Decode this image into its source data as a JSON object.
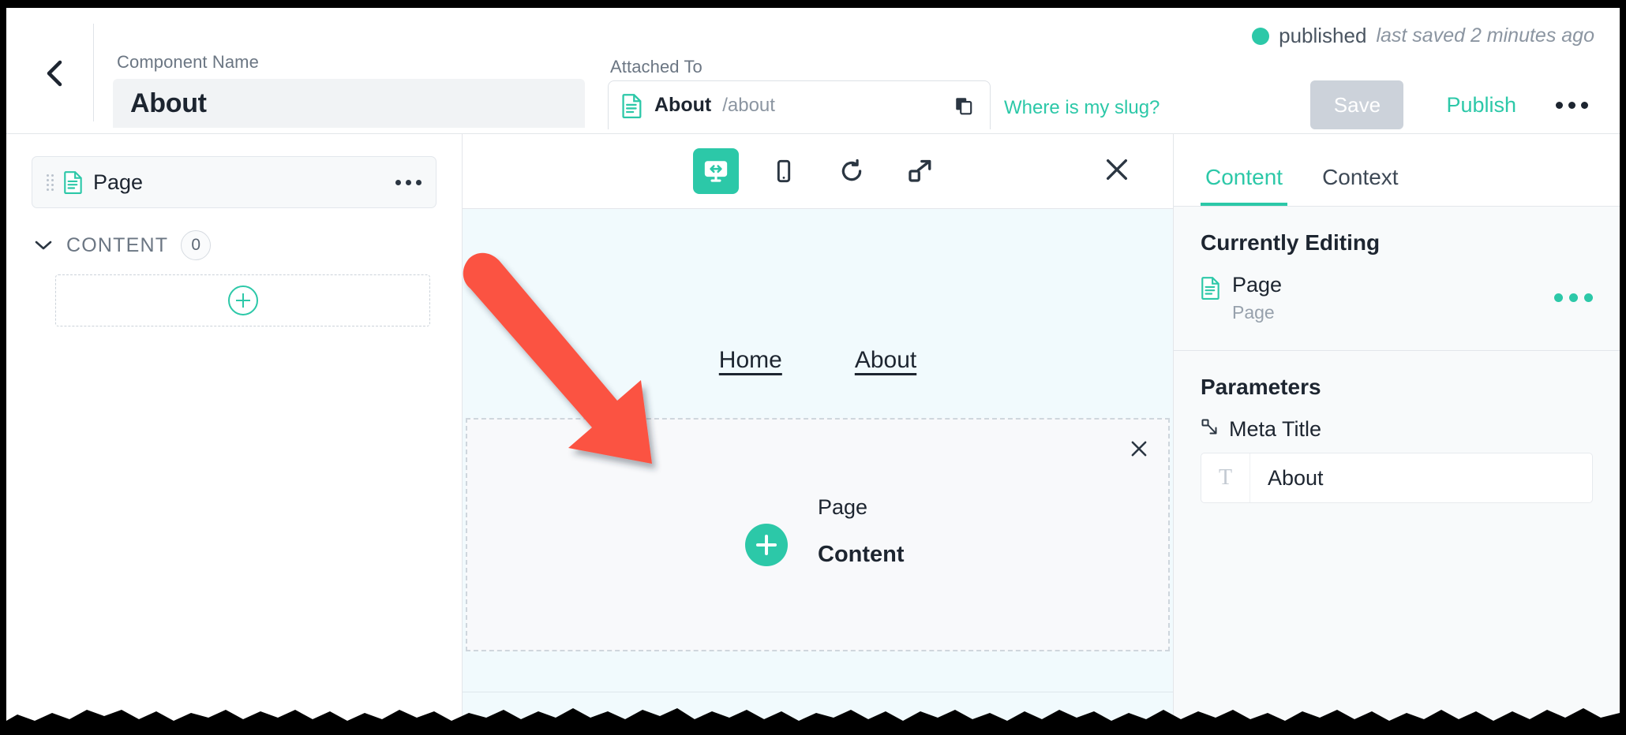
{
  "header": {
    "back_icon": "chevron-left-icon",
    "component_name_label": "Component Name",
    "component_name_value": "About",
    "attached_to_label": "Attached To",
    "attached_to_title": "About",
    "attached_to_slug": "/about",
    "attached_doc_icon": "document-icon",
    "copy_icon": "copy-icon",
    "where_is_my_slug": "Where is my slug?",
    "status": "published",
    "status_color": "#2cc8a8",
    "last_saved": "last saved 2 minutes ago",
    "save_label": "Save",
    "publish_label": "Publish",
    "more_icon": "ellipsis-icon"
  },
  "sidebar": {
    "page_row": {
      "label": "Page",
      "icon": "document-icon",
      "drag_icon": "drag-handle-icon",
      "more_icon": "ellipsis-icon"
    },
    "content_group": {
      "chevron_icon": "chevron-down-icon",
      "label": "CONTENT",
      "count": "0"
    },
    "add_slot_icon": "plus-circle-icon"
  },
  "preview": {
    "toolbar": {
      "desktop_icon": "responsive-desktop-icon",
      "mobile_icon": "mobile-icon",
      "refresh_icon": "refresh-icon",
      "open-external_icon": "open-external-icon",
      "close_icon": "close-icon",
      "active_tool": "responsive-desktop-icon"
    },
    "nav_links": [
      "Home",
      "About"
    ],
    "component": {
      "close_icon": "close-icon",
      "slot_plus_icon": "plus-circle-icon",
      "slot_owner": "Page",
      "slot_name": "Content"
    },
    "annotation": {
      "arrow_icon": "red-arrow-icon",
      "arrow_color": "#fb5343"
    },
    "canvas_bg": "#f1fafd"
  },
  "right_panel": {
    "tabs": [
      {
        "label": "Content",
        "active": true
      },
      {
        "label": "Context",
        "active": false
      }
    ],
    "currently_editing": {
      "title": "Currently Editing",
      "icon": "document-icon",
      "name": "Page",
      "type": "Page",
      "more_icon": "ellipsis-icon"
    },
    "parameters": {
      "title": "Parameters",
      "items": [
        {
          "label": "Meta Title",
          "label_icon": "node-output-icon",
          "type_icon": "text-type-icon",
          "value": "About"
        }
      ]
    }
  }
}
